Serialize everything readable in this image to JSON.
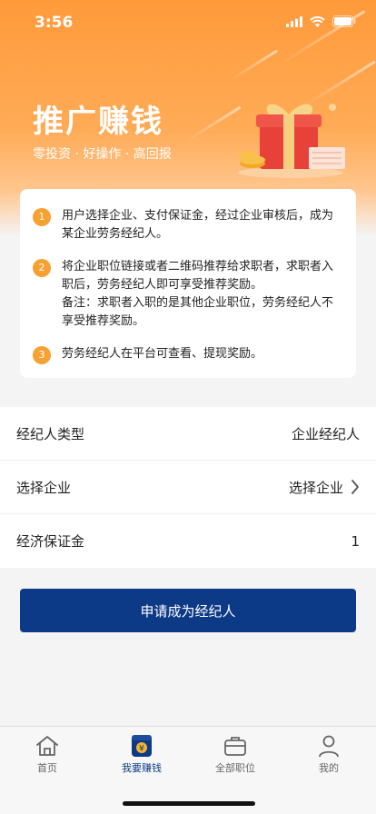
{
  "status_bar": {
    "time": "3:56"
  },
  "hero": {
    "title": "推广赚钱",
    "subtitle": "零投资 · 好操作 · 高回报"
  },
  "steps": [
    {
      "num": "1",
      "text": "用户选择企业、支付保证金，经过企业审核后，成为某企业劳务经纪人。"
    },
    {
      "num": "2",
      "text": "将企业职位链接或者二维码推荐给求职者，求职者入职后，劳务经纪人即可享受推荐奖励。",
      "note": "备注：求职者入职的是其他企业职位，劳务经纪人不享受推荐奖励。"
    },
    {
      "num": "3",
      "text": "劳务经纪人在平台可查看、提现奖励。"
    }
  ],
  "form": {
    "broker_type": {
      "label": "经纪人类型",
      "value": "企业经纪人"
    },
    "company": {
      "label": "选择企业",
      "value": "选择企业"
    },
    "deposit": {
      "label": "经济保证金",
      "value": "1"
    }
  },
  "apply_button": "申请成为经纪人",
  "tabbar": [
    {
      "label": "首页",
      "icon": "home-icon"
    },
    {
      "label": "我要赚钱",
      "icon": "wallet-icon",
      "active": true
    },
    {
      "label": "全部职位",
      "icon": "briefcase-icon"
    },
    {
      "label": "我的",
      "icon": "user-icon"
    }
  ],
  "colors": {
    "accent": "#0d3a86",
    "orange": "#ff9a3a",
    "step_badge": "#f7a132"
  }
}
